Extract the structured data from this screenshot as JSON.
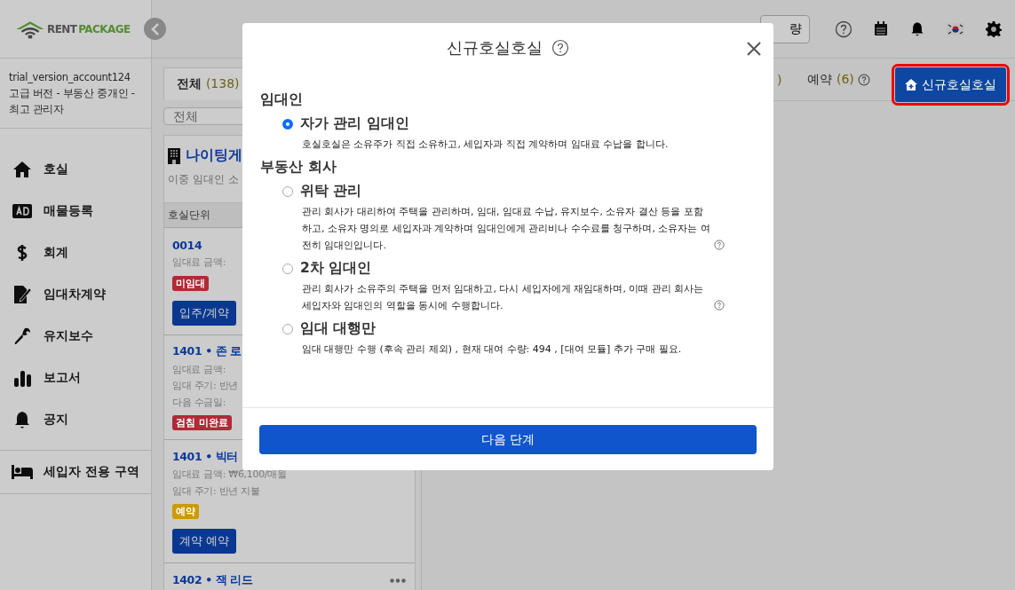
{
  "logo": {
    "word_a": "RENT",
    "word_b": "PACKAGE"
  },
  "header": {
    "partial_button": "량"
  },
  "account": {
    "name": "trial_version_account124",
    "role": "고급 버전 - 부동산 중개인 - 최고 관리자"
  },
  "nav": [
    {
      "label": "호실"
    },
    {
      "label": "매물등록"
    },
    {
      "label": "회계"
    },
    {
      "label": "임대차계약"
    },
    {
      "label": "유지보수"
    },
    {
      "label": "보고서"
    },
    {
      "label": "공지"
    }
  ],
  "tenant_area": {
    "label": "세입자 전용 구역"
  },
  "tabs": [
    {
      "label": "전체",
      "count": "(138)",
      "selected": true
    },
    {
      "label": "예약",
      "count": "(6)",
      "selected": false
    }
  ],
  "hidden_tab_fragment": ")",
  "search": {
    "placeholder": "전체"
  },
  "building": {
    "title": "나이팅게",
    "subtitle": "이중 임대인 소"
  },
  "units_header": "호실단위",
  "units": [
    {
      "title": "0014",
      "lines": [
        "임대료 금액:"
      ],
      "tags": [
        {
          "text": "미임대",
          "color": "#b02a37"
        }
      ],
      "action": "입주/계약"
    },
    {
      "title": "1401 • 존 로",
      "lines": [
        "임대료 금액:",
        "임대 주기: 반년",
        "다음 수금일:"
      ],
      "tags": [
        {
          "text": "검침 미완료",
          "color": "#b02a37"
        }
      ]
    },
    {
      "title": "1401 • 빅터",
      "lines": [
        "임대료 금액: ₩6,100/매월",
        "임대 주기: 반년 지불"
      ],
      "tags": [
        {
          "text": "예약",
          "color": "#cc9a06"
        }
      ],
      "action": "계약 예약"
    },
    {
      "title": "1402 • 잭 리드",
      "more": true
    }
  ],
  "new_unit_button": {
    "label": "신규호실호실",
    "highlighted": true
  },
  "dialog": {
    "title": "신규호실호실",
    "groups": [
      {
        "heading": "임대인",
        "options": [
          {
            "label": "자가 관리 임대인",
            "selected": true,
            "description": "호실호실은 소유주가 직접 소유하고, 세입자과 직접 계약하며 임대료 수납을 합니다.",
            "help": false
          }
        ]
      },
      {
        "heading": "부동산 회사",
        "options": [
          {
            "label": "위탁 관리",
            "selected": false,
            "description": "관리 회사가 대리하여 주택을 관리하며, 임대, 임대료 수납, 유지보수, 소유자 결산 등을 포함하고, 소유자 명의로 세입자과 계약하며 임대인에게 관리비나 수수료를 청구하며, 소유자는 여전히 임대인입니다.",
            "help": true
          },
          {
            "label": "2차 임대인",
            "selected": false,
            "description": "관리 회사가 소유주의 주택을 먼저 임대하고, 다시 세입자에게 재임대하며, 이때 관리 회사는 세입자와 임대인의 역할을 동시에 수행합니다.",
            "help": true
          },
          {
            "label": "임대 대행만",
            "selected": false,
            "description": "임대 대행만 수행 (후속 관리 제외) , 현재 대여 수량: 494 , [대여 모듈] 추가 구매 필요.",
            "help": false
          }
        ]
      }
    ],
    "next_button": "다음 단계"
  }
}
